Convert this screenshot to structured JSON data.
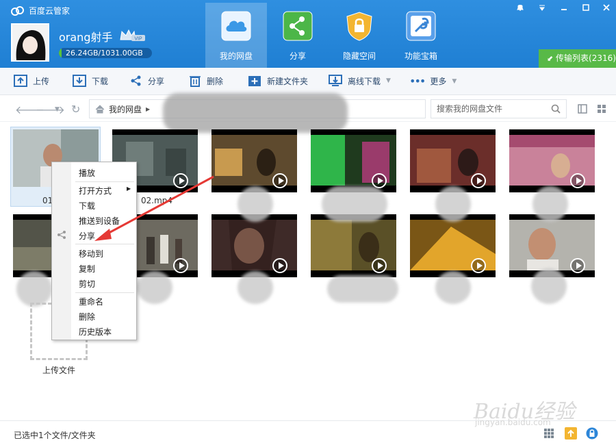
{
  "app": {
    "title": "百度云管家"
  },
  "user": {
    "name": "orang射手",
    "vip_badge": "VIP",
    "quota": "26.24GB/1031.00GB",
    "quota_fraction": 0.025
  },
  "nav": [
    {
      "label": "我的网盘",
      "icon": "cloud-icon",
      "active": true
    },
    {
      "label": "分享",
      "icon": "share-icon",
      "active": false
    },
    {
      "label": "隐藏空间",
      "icon": "lock-icon",
      "active": false
    },
    {
      "label": "功能宝箱",
      "icon": "wrench-icon",
      "active": false
    }
  ],
  "window_controls": [
    "notification-icon",
    "dropdown-icon",
    "minimize-icon",
    "maximize-icon",
    "close-icon"
  ],
  "transfer": {
    "label": "传输列表(2316)"
  },
  "toolbar": {
    "upload": "上传",
    "download": "下载",
    "share": "分享",
    "delete": "删除",
    "new_folder": "新建文件夹",
    "offline_download": "离线下载",
    "more": "更多"
  },
  "address": {
    "root": "我的网盘"
  },
  "search": {
    "placeholder": "搜索我的网盘文件"
  },
  "files": {
    "first": "01",
    "second": "02.mp4"
  },
  "upload_tile": {
    "label": "上传文件"
  },
  "context_menu": {
    "play": "播放",
    "open_with": "打开方式",
    "download": "下载",
    "push_to_device": "推送到设备",
    "share": "分享",
    "move_to": "移动到",
    "copy": "复制",
    "cut": "剪切",
    "rename": "重命名",
    "delete": "删除",
    "history": "历史版本"
  },
  "status": {
    "text": "已选中1个文件/文件夹"
  },
  "watermark": {
    "brand": "Baidu经验",
    "url": "jingyan.baidu.com"
  },
  "colors": {
    "header": "#2384d8",
    "accent_green": "#58b947",
    "arrow_red": "#e53935"
  }
}
